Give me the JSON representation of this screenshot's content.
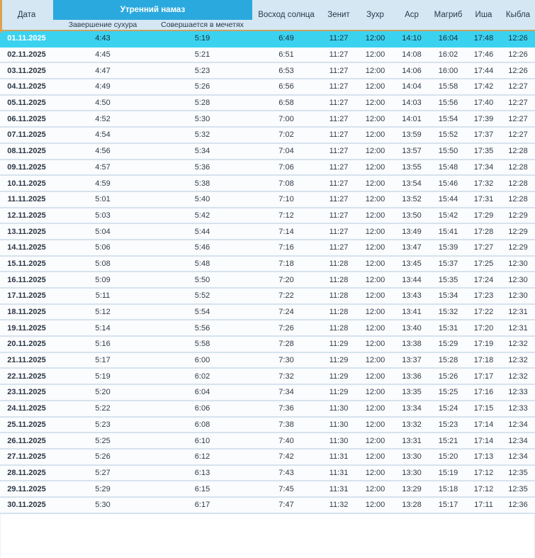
{
  "header": {
    "date_label": "Дата",
    "morning_group": {
      "label": "Утренний намаз",
      "sub_columns": [
        "Завершение сухура",
        "Совершается в мечетях"
      ]
    },
    "columns": [
      "Восход солнца",
      "Зенит",
      "Зухр",
      "Аср",
      "Магриб",
      "Иша",
      "Кыбла"
    ]
  },
  "selected_date": "01.11.2025",
  "rows": [
    {
      "date": "01.11.2025",
      "suhoor_end": "4:43",
      "mosque": "5:19",
      "sunrise": "6:49",
      "zenith": "11:27",
      "zuhr": "12:00",
      "asr": "14:10",
      "maghrib": "16:04",
      "isha": "17:48",
      "qibla": "12:26"
    },
    {
      "date": "02.11.2025",
      "suhoor_end": "4:45",
      "mosque": "5:21",
      "sunrise": "6:51",
      "zenith": "11:27",
      "zuhr": "12:00",
      "asr": "14:08",
      "maghrib": "16:02",
      "isha": "17:46",
      "qibla": "12:26"
    },
    {
      "date": "03.11.2025",
      "suhoor_end": "4:47",
      "mosque": "5:23",
      "sunrise": "6:53",
      "zenith": "11:27",
      "zuhr": "12:00",
      "asr": "14:06",
      "maghrib": "16:00",
      "isha": "17:44",
      "qibla": "12:26"
    },
    {
      "date": "04.11.2025",
      "suhoor_end": "4:49",
      "mosque": "5:26",
      "sunrise": "6:56",
      "zenith": "11:27",
      "zuhr": "12:00",
      "asr": "14:04",
      "maghrib": "15:58",
      "isha": "17:42",
      "qibla": "12:27"
    },
    {
      "date": "05.11.2025",
      "suhoor_end": "4:50",
      "mosque": "5:28",
      "sunrise": "6:58",
      "zenith": "11:27",
      "zuhr": "12:00",
      "asr": "14:03",
      "maghrib": "15:56",
      "isha": "17:40",
      "qibla": "12:27"
    },
    {
      "date": "06.11.2025",
      "suhoor_end": "4:52",
      "mosque": "5:30",
      "sunrise": "7:00",
      "zenith": "11:27",
      "zuhr": "12:00",
      "asr": "14:01",
      "maghrib": "15:54",
      "isha": "17:39",
      "qibla": "12:27"
    },
    {
      "date": "07.11.2025",
      "suhoor_end": "4:54",
      "mosque": "5:32",
      "sunrise": "7:02",
      "zenith": "11:27",
      "zuhr": "12:00",
      "asr": "13:59",
      "maghrib": "15:52",
      "isha": "17:37",
      "qibla": "12:27"
    },
    {
      "date": "08.11.2025",
      "suhoor_end": "4:56",
      "mosque": "5:34",
      "sunrise": "7:04",
      "zenith": "11:27",
      "zuhr": "12:00",
      "asr": "13:57",
      "maghrib": "15:50",
      "isha": "17:35",
      "qibla": "12:28"
    },
    {
      "date": "09.11.2025",
      "suhoor_end": "4:57",
      "mosque": "5:36",
      "sunrise": "7:06",
      "zenith": "11:27",
      "zuhr": "12:00",
      "asr": "13:55",
      "maghrib": "15:48",
      "isha": "17:34",
      "qibla": "12:28"
    },
    {
      "date": "10.11.2025",
      "suhoor_end": "4:59",
      "mosque": "5:38",
      "sunrise": "7:08",
      "zenith": "11:27",
      "zuhr": "12:00",
      "asr": "13:54",
      "maghrib": "15:46",
      "isha": "17:32",
      "qibla": "12:28"
    },
    {
      "date": "11.11.2025",
      "suhoor_end": "5:01",
      "mosque": "5:40",
      "sunrise": "7:10",
      "zenith": "11:27",
      "zuhr": "12:00",
      "asr": "13:52",
      "maghrib": "15:44",
      "isha": "17:31",
      "qibla": "12:28"
    },
    {
      "date": "12.11.2025",
      "suhoor_end": "5:03",
      "mosque": "5:42",
      "sunrise": "7:12",
      "zenith": "11:27",
      "zuhr": "12:00",
      "asr": "13:50",
      "maghrib": "15:42",
      "isha": "17:29",
      "qibla": "12:29"
    },
    {
      "date": "13.11.2025",
      "suhoor_end": "5:04",
      "mosque": "5:44",
      "sunrise": "7:14",
      "zenith": "11:27",
      "zuhr": "12:00",
      "asr": "13:49",
      "maghrib": "15:41",
      "isha": "17:28",
      "qibla": "12:29"
    },
    {
      "date": "14.11.2025",
      "suhoor_end": "5:06",
      "mosque": "5:46",
      "sunrise": "7:16",
      "zenith": "11:27",
      "zuhr": "12:00",
      "asr": "13:47",
      "maghrib": "15:39",
      "isha": "17:27",
      "qibla": "12:29"
    },
    {
      "date": "15.11.2025",
      "suhoor_end": "5:08",
      "mosque": "5:48",
      "sunrise": "7:18",
      "zenith": "11:28",
      "zuhr": "12:00",
      "asr": "13:45",
      "maghrib": "15:37",
      "isha": "17:25",
      "qibla": "12:30"
    },
    {
      "date": "16.11.2025",
      "suhoor_end": "5:09",
      "mosque": "5:50",
      "sunrise": "7:20",
      "zenith": "11:28",
      "zuhr": "12:00",
      "asr": "13:44",
      "maghrib": "15:35",
      "isha": "17:24",
      "qibla": "12:30"
    },
    {
      "date": "17.11.2025",
      "suhoor_end": "5:11",
      "mosque": "5:52",
      "sunrise": "7:22",
      "zenith": "11:28",
      "zuhr": "12:00",
      "asr": "13:43",
      "maghrib": "15:34",
      "isha": "17:23",
      "qibla": "12:30"
    },
    {
      "date": "18.11.2025",
      "suhoor_end": "5:12",
      "mosque": "5:54",
      "sunrise": "7:24",
      "zenith": "11:28",
      "zuhr": "12:00",
      "asr": "13:41",
      "maghrib": "15:32",
      "isha": "17:22",
      "qibla": "12:31"
    },
    {
      "date": "19.11.2025",
      "suhoor_end": "5:14",
      "mosque": "5:56",
      "sunrise": "7:26",
      "zenith": "11:28",
      "zuhr": "12:00",
      "asr": "13:40",
      "maghrib": "15:31",
      "isha": "17:20",
      "qibla": "12:31"
    },
    {
      "date": "20.11.2025",
      "suhoor_end": "5:16",
      "mosque": "5:58",
      "sunrise": "7:28",
      "zenith": "11:29",
      "zuhr": "12:00",
      "asr": "13:38",
      "maghrib": "15:29",
      "isha": "17:19",
      "qibla": "12:32"
    },
    {
      "date": "21.11.2025",
      "suhoor_end": "5:17",
      "mosque": "6:00",
      "sunrise": "7:30",
      "zenith": "11:29",
      "zuhr": "12:00",
      "asr": "13:37",
      "maghrib": "15:28",
      "isha": "17:18",
      "qibla": "12:32"
    },
    {
      "date": "22.11.2025",
      "suhoor_end": "5:19",
      "mosque": "6:02",
      "sunrise": "7:32",
      "zenith": "11:29",
      "zuhr": "12:00",
      "asr": "13:36",
      "maghrib": "15:26",
      "isha": "17:17",
      "qibla": "12:32"
    },
    {
      "date": "23.11.2025",
      "suhoor_end": "5:20",
      "mosque": "6:04",
      "sunrise": "7:34",
      "zenith": "11:29",
      "zuhr": "12:00",
      "asr": "13:35",
      "maghrib": "15:25",
      "isha": "17:16",
      "qibla": "12:33"
    },
    {
      "date": "24.11.2025",
      "suhoor_end": "5:22",
      "mosque": "6:06",
      "sunrise": "7:36",
      "zenith": "11:30",
      "zuhr": "12:00",
      "asr": "13:34",
      "maghrib": "15:24",
      "isha": "17:15",
      "qibla": "12:33"
    },
    {
      "date": "25.11.2025",
      "suhoor_end": "5:23",
      "mosque": "6:08",
      "sunrise": "7:38",
      "zenith": "11:30",
      "zuhr": "12:00",
      "asr": "13:32",
      "maghrib": "15:23",
      "isha": "17:14",
      "qibla": "12:34"
    },
    {
      "date": "26.11.2025",
      "suhoor_end": "5:25",
      "mosque": "6:10",
      "sunrise": "7:40",
      "zenith": "11:30",
      "zuhr": "12:00",
      "asr": "13:31",
      "maghrib": "15:21",
      "isha": "17:14",
      "qibla": "12:34"
    },
    {
      "date": "27.11.2025",
      "suhoor_end": "5:26",
      "mosque": "6:12",
      "sunrise": "7:42",
      "zenith": "11:31",
      "zuhr": "12:00",
      "asr": "13:30",
      "maghrib": "15:20",
      "isha": "17:13",
      "qibla": "12:34"
    },
    {
      "date": "28.11.2025",
      "suhoor_end": "5:27",
      "mosque": "6:13",
      "sunrise": "7:43",
      "zenith": "11:31",
      "zuhr": "12:00",
      "asr": "13:30",
      "maghrib": "15:19",
      "isha": "17:12",
      "qibla": "12:35"
    },
    {
      "date": "29.11.2025",
      "suhoor_end": "5:29",
      "mosque": "6:15",
      "sunrise": "7:45",
      "zenith": "11:31",
      "zuhr": "12:00",
      "asr": "13:29",
      "maghrib": "15:18",
      "isha": "17:12",
      "qibla": "12:35"
    },
    {
      "date": "30.11.2025",
      "suhoor_end": "5:30",
      "mosque": "6:17",
      "sunrise": "7:47",
      "zenith": "11:32",
      "zuhr": "12:00",
      "asr": "13:28",
      "maghrib": "15:17",
      "isha": "17:11",
      "qibla": "12:36"
    }
  ],
  "colors": {
    "accent_cyan": "#2aa9de",
    "highlight_row": "#3bd2f0",
    "header_bg": "#d5e7f3",
    "header_text": "#27384a",
    "accent_tan": "#c9a264",
    "accent_orange": "#dda24f",
    "row_bg": "#fbfcfe",
    "row_sep": "#d6e3ee",
    "cell_text": "#2f3b47",
    "date_text": "#2b3744",
    "edge_line": "#e4ebf1"
  }
}
